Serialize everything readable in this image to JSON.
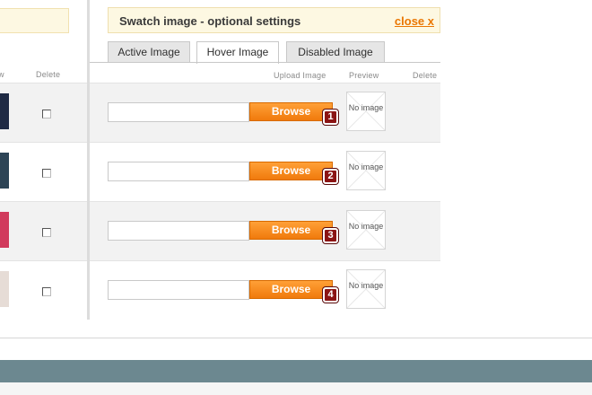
{
  "left_panel": {
    "headers": {
      "preview_fragment": "w",
      "delete": "Delete"
    },
    "rows": [
      {
        "swatch_color": "#1f2a44"
      },
      {
        "swatch_color": "#2d4456"
      },
      {
        "swatch_color": "#d13a5c"
      },
      {
        "swatch_color": "#e6dcd6"
      }
    ]
  },
  "swatch_panel": {
    "title": "Swatch image - optional settings",
    "close_label": "close x",
    "tabs": [
      {
        "label": "Active Image",
        "active": false
      },
      {
        "label": "Hover Image",
        "active": true
      },
      {
        "label": "Disabled Image",
        "active": false
      }
    ],
    "column_headers": {
      "upload": "Upload Image",
      "preview": "Preview",
      "delete": "Delete"
    },
    "browse_label": "Browse",
    "preview_placeholder": "No image",
    "rows": [
      {
        "badge": "1"
      },
      {
        "badge": "2"
      },
      {
        "badge": "3"
      },
      {
        "badge": "4"
      }
    ]
  },
  "colors": {
    "accent": "#f07a0c",
    "badge": "#8b1414",
    "header_bg": "#fdf8e2",
    "footer": "#6c8890"
  }
}
